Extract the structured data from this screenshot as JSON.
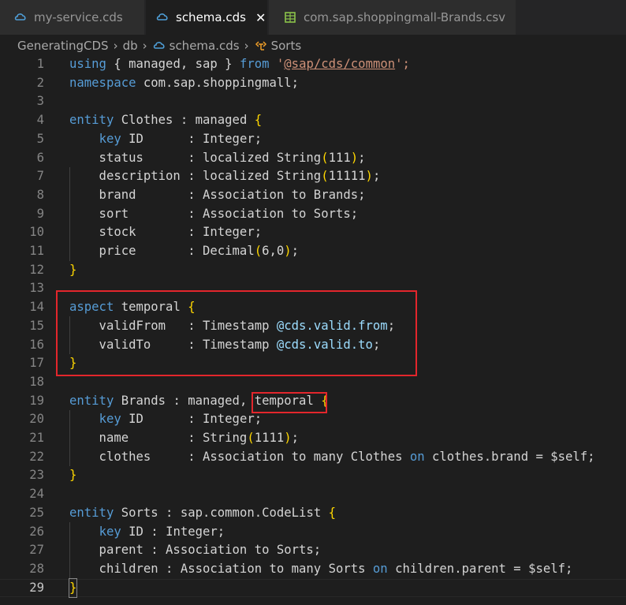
{
  "tabs": [
    {
      "label": "my-service.cds",
      "icon": "cds-file-icon",
      "active": false
    },
    {
      "label": "schema.cds",
      "icon": "cds-file-icon",
      "active": true,
      "close": "✕"
    },
    {
      "label": "com.sap.shoppingmall-Brands.csv",
      "icon": "csv-file-icon",
      "active": false
    }
  ],
  "breadcrumb": {
    "items": [
      "GeneratingCDS",
      "db",
      "schema.cds",
      "Sorts"
    ],
    "separator": "›"
  },
  "editor": {
    "current_line": 29,
    "lines": [
      {
        "n": "1"
      },
      {
        "n": "2"
      },
      {
        "n": "3"
      },
      {
        "n": "4"
      },
      {
        "n": "5"
      },
      {
        "n": "6"
      },
      {
        "n": "7"
      },
      {
        "n": "8"
      },
      {
        "n": "9"
      },
      {
        "n": "10"
      },
      {
        "n": "11"
      },
      {
        "n": "12"
      },
      {
        "n": "13"
      },
      {
        "n": "14"
      },
      {
        "n": "15"
      },
      {
        "n": "16"
      },
      {
        "n": "17"
      },
      {
        "n": "18"
      },
      {
        "n": "19"
      },
      {
        "n": "20"
      },
      {
        "n": "21"
      },
      {
        "n": "22"
      },
      {
        "n": "23"
      },
      {
        "n": "24"
      },
      {
        "n": "25"
      },
      {
        "n": "26"
      },
      {
        "n": "27"
      },
      {
        "n": "28"
      },
      {
        "n": "29"
      }
    ],
    "tokens": {
      "l1": [
        "using",
        " { managed, sap } ",
        "from",
        " '",
        "@sap/cds/common",
        "';"
      ],
      "l2": [
        "namespace",
        " com.sap.shoppingmall;"
      ],
      "l4": [
        "entity",
        " Clothes : managed ",
        "{"
      ],
      "l5": [
        "    ",
        "key",
        " ID      : Integer;"
      ],
      "l6": [
        "    status      : localized String",
        "(",
        "111",
        ")",
        ";"
      ],
      "l7": [
        "    description : localized String",
        "(",
        "11111",
        ")",
        ";"
      ],
      "l8": [
        "    brand       : Association to Brands;"
      ],
      "l9": [
        "    sort        : Association to Sorts;"
      ],
      "l10": [
        "    stock       : Integer;"
      ],
      "l11": [
        "    price       : Decimal",
        "(",
        "6,0",
        ")",
        ";"
      ],
      "l12": [
        "}"
      ],
      "l14": [
        "aspect",
        " temporal ",
        "{"
      ],
      "l15": [
        "    validFrom   : Timestamp ",
        "@cds.valid.from",
        ";"
      ],
      "l16": [
        "    validTo     : Timestamp ",
        "@cds.valid.to",
        ";"
      ],
      "l17": [
        "}"
      ],
      "l19": [
        "entity",
        " Brands : managed, temporal ",
        "{"
      ],
      "l20": [
        "    ",
        "key",
        " ID      : Integer;"
      ],
      "l21": [
        "    name        : String",
        "(",
        "1111",
        ")",
        ";"
      ],
      "l22": [
        "    clothes     : Association to many Clothes ",
        "on",
        " clothes.brand = $self;"
      ],
      "l23": [
        "}"
      ],
      "l25": [
        "entity",
        " Sorts : sap.common.CodeList ",
        "{"
      ],
      "l26": [
        "    ",
        "key",
        " ID : Integer;"
      ],
      "l27": [
        "    parent : Association to Sorts;"
      ],
      "l28": [
        "    children : Association to many Sorts ",
        "on",
        " children.parent = $self;"
      ],
      "l29": [
        "}"
      ]
    }
  },
  "colors": {
    "keyword": "#569cd6",
    "string": "#ce9178",
    "bracket": "#ffd700",
    "annotation": "#9cdcfe",
    "highlight": "#e3262c"
  }
}
